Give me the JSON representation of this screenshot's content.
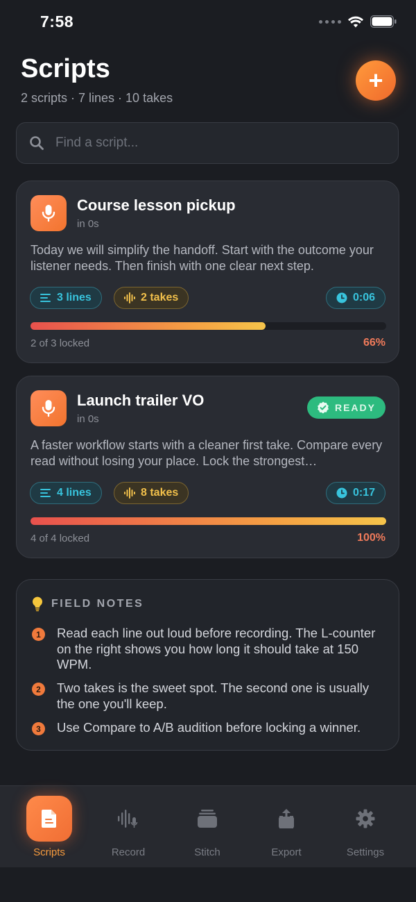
{
  "status_bar": {
    "time": "7:58"
  },
  "header": {
    "title": "Scripts",
    "subtitle": "2 scripts · 7 lines · 10 takes",
    "add_label": "+"
  },
  "search": {
    "placeholder": "Find a script..."
  },
  "scripts": [
    {
      "title": "Course lesson pickup",
      "meta": "in 0s",
      "description": "Today we will simplify the handoff. Start with the outcome your listener needs. Then finish with one clear next step.",
      "lines": "3 lines",
      "takes": "2 takes",
      "duration": "0:06",
      "locked": "2 of 3 locked",
      "percent": "66%",
      "progress": 0.66
    },
    {
      "title": "Launch trailer VO",
      "meta": "in 0s",
      "badge": "READY",
      "description": "A faster workflow starts with a cleaner first take. Compare every read without losing your place. Lock the strongest…",
      "lines": "4 lines",
      "takes": "8 takes",
      "duration": "0:17",
      "locked": "4 of 4 locked",
      "percent": "100%",
      "progress": 1.0
    }
  ],
  "field_notes": {
    "title": "FIELD NOTES",
    "items": [
      {
        "num": "1",
        "text": "Read each line out loud before recording. The L-counter on the right shows you how long it should take at 150 WPM."
      },
      {
        "num": "2",
        "text": "Two takes is the sweet spot. The second one is usually the one you'll keep."
      },
      {
        "num": "3",
        "text": "Use Compare to A/B audition before locking a winner."
      }
    ]
  },
  "tabs": [
    {
      "label": "Scripts",
      "icon": "document-icon",
      "active": true
    },
    {
      "label": "Record",
      "icon": "waveform-mic-icon",
      "active": false
    },
    {
      "label": "Stitch",
      "icon": "stack-icon",
      "active": false
    },
    {
      "label": "Export",
      "icon": "share-icon",
      "active": false
    },
    {
      "label": "Settings",
      "icon": "gear-icon",
      "active": false
    }
  ],
  "colors": {
    "background": "#1b1d22",
    "accent": "#f06e34",
    "teal": "#38c4dd",
    "gold": "#f2c04b",
    "ready": "#2dbb7f"
  }
}
